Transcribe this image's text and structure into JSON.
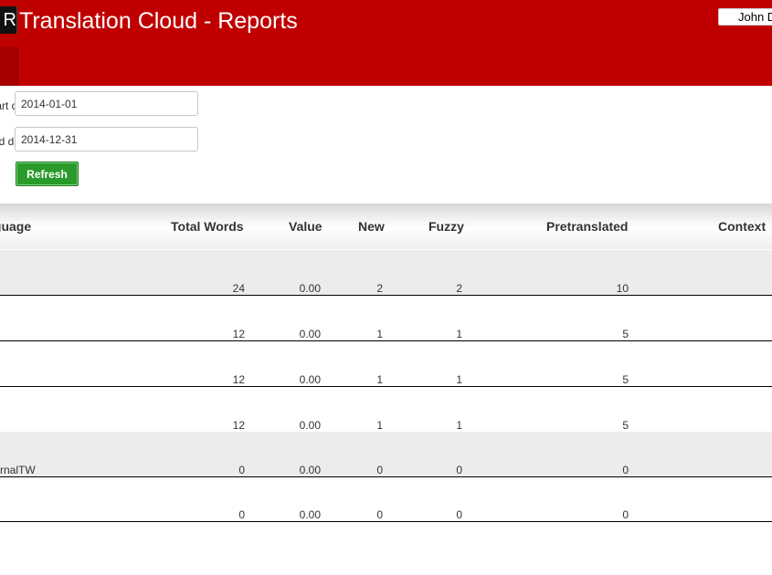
{
  "header": {
    "logo_text": "R",
    "title": "Translation Cloud - Reports",
    "user": "John D"
  },
  "form": {
    "start_label": "Start date:",
    "start_value": "2014-01-01",
    "end_label": "End date:",
    "end_value": "2014-12-31",
    "refresh_label": "Refresh"
  },
  "table": {
    "columns": [
      "Language",
      "Total Words",
      "Value",
      "New",
      "Fuzzy",
      "Pretranslated",
      "Context"
    ],
    "rows": [
      {
        "language": "",
        "total": "24",
        "value": "0.00",
        "new": "2",
        "fuzzy": "2",
        "pretranslated": "10"
      },
      {
        "language": "",
        "total": "12",
        "value": "0.00",
        "new": "1",
        "fuzzy": "1",
        "pretranslated": "5"
      },
      {
        "language": "",
        "total": "12",
        "value": "0.00",
        "new": "1",
        "fuzzy": "1",
        "pretranslated": "5"
      },
      {
        "language": "",
        "total": "12",
        "value": "0.00",
        "new": "1",
        "fuzzy": "1",
        "pretranslated": "5"
      },
      {
        "language": "InternalTW",
        "total": "0",
        "value": "0.00",
        "new": "0",
        "fuzzy": "0",
        "pretranslated": "0"
      },
      {
        "language": "",
        "total": "0",
        "value": "0.00",
        "new": "0",
        "fuzzy": "0",
        "pretranslated": "0"
      }
    ]
  },
  "colors": {
    "header_bg": "#c00000",
    "refresh_bg": "#2a9a2a"
  }
}
